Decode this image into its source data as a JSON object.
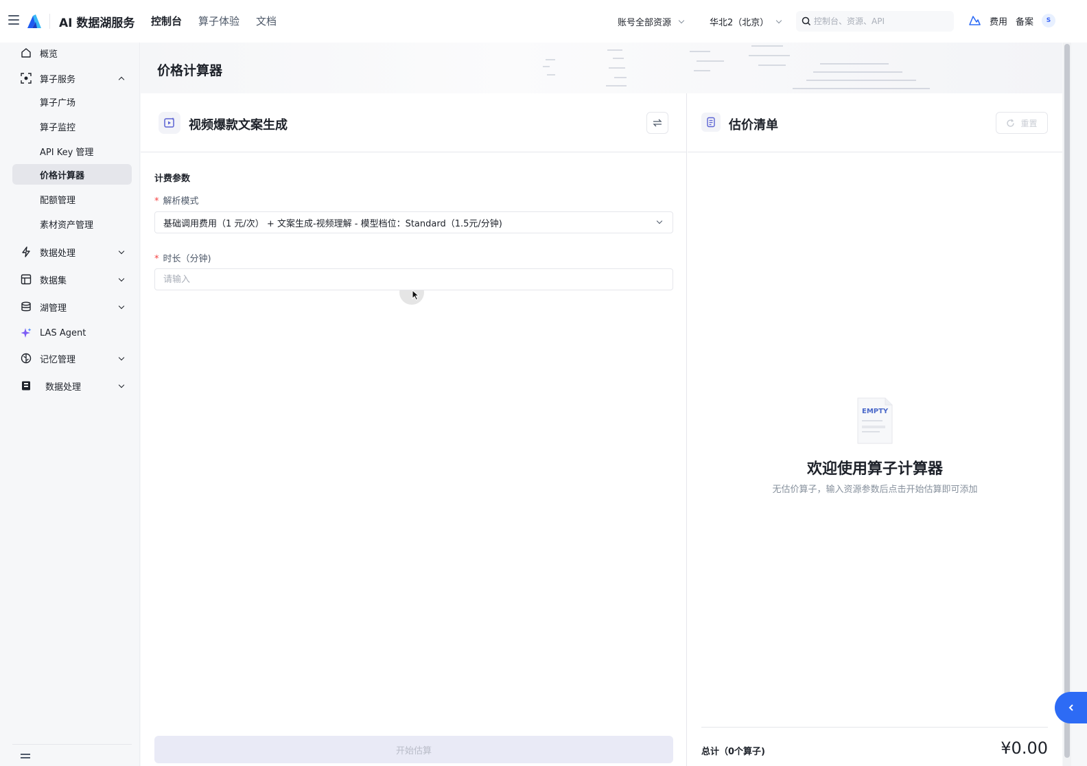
{
  "topbar": {
    "app_title": "AI 数据湖服务",
    "nav": [
      {
        "label": "控制台",
        "active": true
      },
      {
        "label": "算子体验",
        "active": false
      },
      {
        "label": "文档",
        "active": false
      }
    ],
    "account_select": "账号全部资源",
    "region_select": "华北2（北京）",
    "search_placeholder": "控制台、资源、API",
    "fee_label": "费用",
    "record_label": "备案",
    "avatar_letter": "S"
  },
  "sidebar": {
    "items": [
      {
        "label": "概览",
        "icon": "home-icon"
      },
      {
        "label": "算子服务",
        "icon": "operator-icon",
        "expanded": true
      },
      {
        "label": "算子广场"
      },
      {
        "label": "算子监控"
      },
      {
        "label": "API Key 管理"
      },
      {
        "label": "价格计算器",
        "selected": true
      },
      {
        "label": "配额管理"
      },
      {
        "label": "素材资产管理"
      },
      {
        "label": "数据处理",
        "icon": "lightning-icon"
      },
      {
        "label": "数据集",
        "icon": "table-icon"
      },
      {
        "label": "湖管理",
        "icon": "database-icon"
      },
      {
        "label": "LAS Agent",
        "icon": "sparkle-icon"
      },
      {
        "label": "记忆管理",
        "icon": "brain-icon"
      },
      {
        "label": "数据处理",
        "icon": "notebook-icon"
      }
    ]
  },
  "page": {
    "title": "价格计算器"
  },
  "calculator": {
    "operator_name": "视频爆款文案生成",
    "section_label": "计费参数",
    "mode_label": "解析模式",
    "mode_value": "基础调用费用（1 元/次） + 文案生成-视频理解 - 模型档位：Standard（1.5元/分钟)",
    "duration_label": "时长（分钟)",
    "duration_placeholder": "请输入",
    "start_button": "开始估算",
    "required_mark": "*"
  },
  "estimate": {
    "title": "估价清单",
    "reset_button": "重置",
    "empty_badge": "EMPTY",
    "empty_title": "欢迎使用算子计算器",
    "empty_desc": "无估价算子，输入资源参数后点击开始估算即可添加",
    "total_label": "总计（0个算子)",
    "total_value": "¥0.00"
  },
  "colors": {
    "brand": "#2d6bf5",
    "required": "#f53f3f",
    "selected_bg": "#e5e6eb",
    "disabled_button_bg": "#e9eaf6"
  }
}
